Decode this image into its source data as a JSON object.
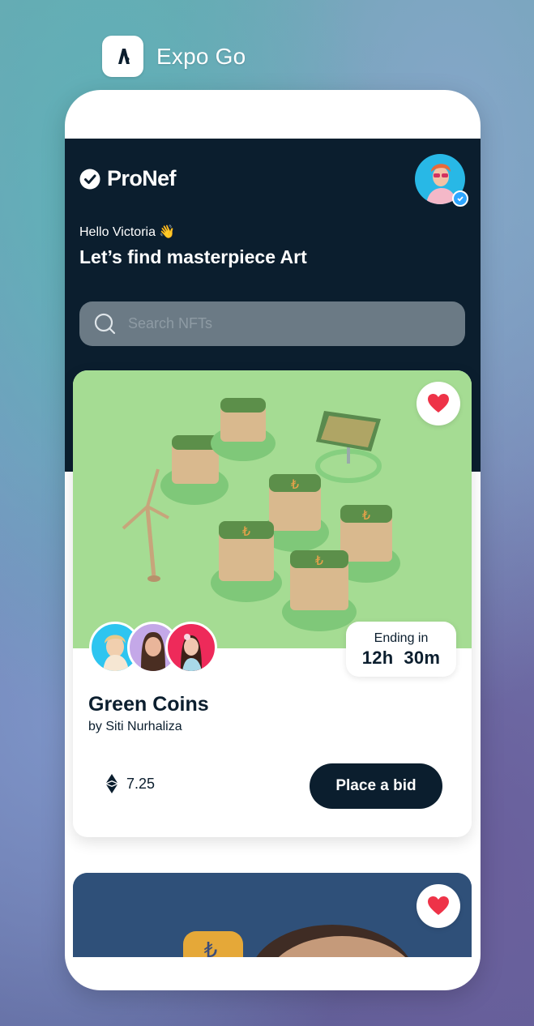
{
  "switcher": {
    "app_name": "Expo Go"
  },
  "app": {
    "brand": "ProNef",
    "greeting": "Hello Victoria 👋",
    "headline": "Let’s find masterpiece Art",
    "search": {
      "placeholder": "Search NFTs",
      "value": ""
    }
  },
  "featured": {
    "title": "Green Coins",
    "author": "by Siti Nurhaliza",
    "ending_label": "Ending in",
    "ending_time": "12h  30m",
    "price": "7.25",
    "bid_label": "Place a bid",
    "favorited": true
  },
  "colors": {
    "dark": "#0b1e2e",
    "heart": "#ee3348",
    "art_bg": "#a5dc93",
    "card2_bg": "#2f5079"
  },
  "icons": [
    "expo-go-app-icon",
    "check-circle-icon",
    "search-icon",
    "heart-icon",
    "ethereum-icon"
  ]
}
